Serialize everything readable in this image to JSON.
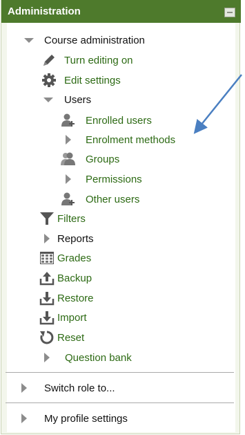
{
  "header": {
    "title": "Administration"
  },
  "menu": {
    "course_admin": "Course administration",
    "turn_editing_on": "Turn editing on",
    "edit_settings": "Edit settings",
    "users": "Users",
    "enrolled_users": "Enrolled users",
    "enrolment_methods": "Enrolment methods",
    "groups": "Groups",
    "permissions": "Permissions",
    "other_users": "Other users",
    "filters": "Filters",
    "reports": "Reports",
    "grades": "Grades",
    "backup": "Backup",
    "restore": "Restore",
    "import": "Import",
    "reset": "Reset",
    "question_bank": "Question bank",
    "switch_role": "Switch role to...",
    "my_profile": "My profile settings"
  },
  "colors": {
    "header_bg": "#4e7a2c",
    "link": "#2d6a14",
    "icon": "#555555",
    "arrow": "#4a7fc1"
  }
}
